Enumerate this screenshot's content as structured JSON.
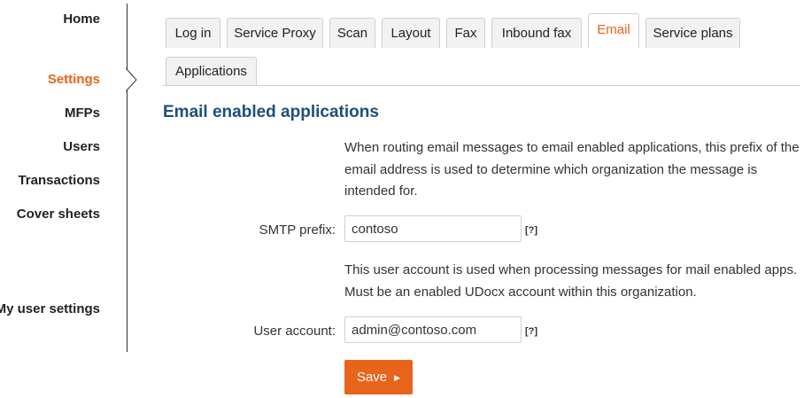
{
  "sidebar": {
    "items": [
      {
        "label": "Home",
        "active": false
      },
      {
        "label": "Settings",
        "active": true
      },
      {
        "label": "MFPs",
        "active": false
      },
      {
        "label": "Users",
        "active": false
      },
      {
        "label": "Transactions",
        "active": false
      },
      {
        "label": "Cover sheets",
        "active": false
      },
      {
        "label": "My user settings",
        "active": false
      }
    ]
  },
  "tabs": [
    {
      "label": "Log in"
    },
    {
      "label": "Service Proxy"
    },
    {
      "label": "Scan"
    },
    {
      "label": "Layout"
    },
    {
      "label": "Fax"
    },
    {
      "label": "Inbound fax"
    },
    {
      "label": "Email",
      "active": true
    },
    {
      "label": "Service plans"
    },
    {
      "label": "Applications"
    }
  ],
  "main": {
    "title": "Email enabled applications",
    "smtp": {
      "desc_lines": [
        "When routing email messages to email enabled applications, this prefix of the",
        "email address is used to determine which organization the message is",
        "intended for."
      ],
      "label": "SMTP prefix:",
      "value": "contoso",
      "help": "[?]"
    },
    "account": {
      "desc_lines": [
        "This user account is used when processing messages for mail enabled apps.",
        "Must be an enabled UDocx account within this organization."
      ],
      "label": "User account:",
      "value": "admin@contoso.com",
      "help": "[?]"
    },
    "save_label": "Save"
  },
  "colors": {
    "accent": "#e8641b",
    "title": "#1d4f7a"
  }
}
